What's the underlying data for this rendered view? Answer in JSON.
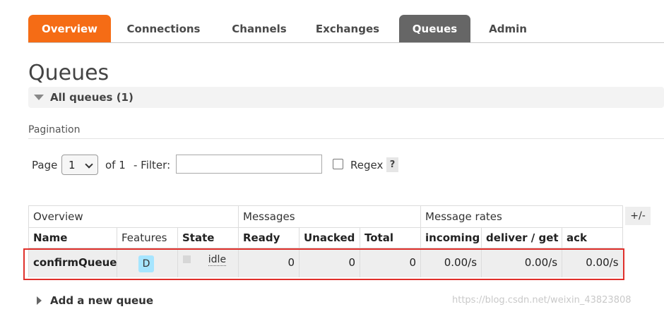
{
  "nav": {
    "tabs": [
      {
        "label": "Overview",
        "active_style": "orange"
      },
      {
        "label": "Connections"
      },
      {
        "label": "Channels"
      },
      {
        "label": "Exchanges"
      },
      {
        "label": "Queues",
        "active_style": "grey"
      },
      {
        "label": "Admin"
      }
    ]
  },
  "page": {
    "title": "Queues",
    "section_label": "All queues (1)",
    "pagination_label": "Pagination"
  },
  "filter": {
    "page_label": "Page",
    "page_value": "1",
    "of_label": "of 1",
    "filter_label": "- Filter:",
    "filter_value": "",
    "regex_label": "Regex",
    "regex_checked": false,
    "help_label": "?"
  },
  "table": {
    "groups": [
      "Overview",
      "Messages",
      "Message rates"
    ],
    "columns": [
      "Name",
      "Features",
      "State",
      "Ready",
      "Unacked",
      "Total",
      "incoming",
      "deliver / get",
      "ack"
    ],
    "plus_minus": "+/-",
    "rows": [
      {
        "name": "confirmQueue",
        "feature": "D",
        "state": "idle",
        "ready": "0",
        "unacked": "0",
        "total": "0",
        "incoming": "0.00/s",
        "deliver_get": "0.00/s",
        "ack": "0.00/s"
      }
    ]
  },
  "add_queue_label": "Add a new queue",
  "watermark": "https://blog.csdn.net/weixin_43823808",
  "colors": {
    "tab_active_orange": "#f56c15",
    "tab_active_grey": "#666666",
    "feature_badge": "#a6e5ff",
    "highlight_border": "#e0302b"
  }
}
